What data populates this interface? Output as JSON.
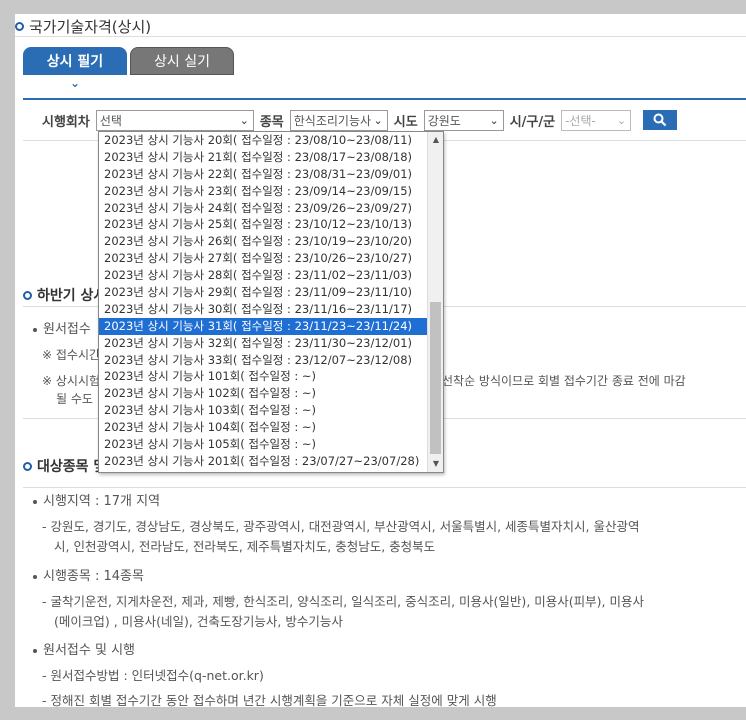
{
  "page_title": "국가기술자격(상시)",
  "tabs": [
    {
      "label": "상시 필기",
      "active": true
    },
    {
      "label": "상시 실기",
      "active": false
    }
  ],
  "search": {
    "round_label": "시행회차",
    "round_value": "선택",
    "category_label": "종목",
    "category_value": "한식조리기능사",
    "province_label": "시도",
    "province_value": "강원도",
    "city_label": "시/구/군",
    "city_value": "-선택-"
  },
  "dropdown": {
    "options": [
      "2023년 상시 기능사 20회( 접수일정 : 23/08/10~23/08/11)",
      "2023년 상시 기능사 21회( 접수일정 : 23/08/17~23/08/18)",
      "2023년 상시 기능사 22회( 접수일정 : 23/08/31~23/09/01)",
      "2023년 상시 기능사 23회( 접수일정 : 23/09/14~23/09/15)",
      "2023년 상시 기능사 24회( 접수일정 : 23/09/26~23/09/27)",
      "2023년 상시 기능사 25회( 접수일정 : 23/10/12~23/10/13)",
      "2023년 상시 기능사 26회( 접수일정 : 23/10/19~23/10/20)",
      "2023년 상시 기능사 27회( 접수일정 : 23/10/26~23/10/27)",
      "2023년 상시 기능사 28회( 접수일정 : 23/11/02~23/11/03)",
      "2023년 상시 기능사 29회( 접수일정 : 23/11/09~23/11/10)",
      "2023년 상시 기능사 30회( 접수일정 : 23/11/16~23/11/17)",
      "2023년 상시 기능사 31회( 접수일정 : 23/11/23~23/11/24)",
      "2023년 상시 기능사 32회( 접수일정 : 23/11/30~23/12/01)",
      "2023년 상시 기능사 33회( 접수일정 : 23/12/07~23/12/08)",
      "2023년 상시 기능사 101회( 접수일정 : ~)",
      "2023년 상시 기능사 102회( 접수일정 : ~)",
      "2023년 상시 기능사 103회( 접수일정 : ~)",
      "2023년 상시 기능사 104회( 접수일정 : ~)",
      "2023년 상시 기능사 105회( 접수일정 : ~)",
      "2023년 상시 기능사 201회( 접수일정 : 23/07/27~23/07/28)"
    ],
    "selected_index": 11
  },
  "section1": {
    "title": "하반기 상시",
    "item1": "원서접수",
    "note1": "※ 접수시간",
    "note2_left": "※ 상시시험",
    "note2_right": "선착순 방식이므로 회별 접수기간 종료 전에 마감",
    "note2_line2": "될 수도"
  },
  "section2": {
    "title": "대상종목 및",
    "region_label": "시행지역 : 17개 지역",
    "region_list_1": "- 강원도, 경기도, 경상남도, 경상북도, 광주광역시, 대전광역시, 부산광역시, 서울특별시, 세종특별자치시, 울산광역",
    "region_list_2": "시, 인천광역시, 전라남도, 전라북도, 제주특별자치도, 충청남도, 충청북도",
    "types_label": "시행종목 : 14종목",
    "types_list_1": "- 굴착기운전, 지게차운전, 제과, 제빵, 한식조리, 양식조리, 일식조리, 중식조리, 미용사(일반), 미용사(피부), 미용사",
    "types_list_2": "(메이크업) , 미용사(네일), 건축도장기능사, 방수기능사",
    "apply_label": "원서접수 및 시행",
    "apply_method": "- 원서접수방법 : 인터넷접수(q-net.or.kr)",
    "apply_note": "- 정해진 회별 접수기간 동안 접수하며 년간 시행계획을 기준으로 자체 실정에 맞게 시행"
  }
}
